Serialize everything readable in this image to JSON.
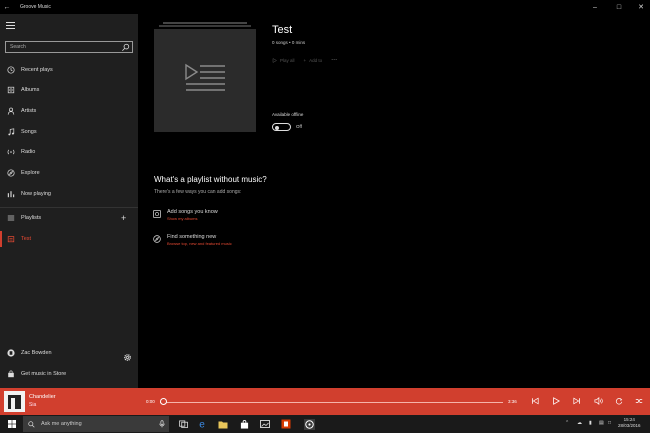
{
  "window": {
    "title": "Groove Music"
  },
  "sidebar": {
    "search_placeholder": "Search",
    "items": [
      {
        "label": "Recent plays",
        "icon": "clock-icon"
      },
      {
        "label": "Albums",
        "icon": "album-icon"
      },
      {
        "label": "Artists",
        "icon": "person-icon"
      },
      {
        "label": "Songs",
        "icon": "music-note-icon"
      },
      {
        "label": "Radio",
        "icon": "radio-icon"
      },
      {
        "label": "Explore",
        "icon": "explore-icon"
      },
      {
        "label": "Now playing",
        "icon": "equalizer-icon"
      }
    ],
    "playlists_label": "Playlists",
    "playlists": [
      {
        "label": "Test",
        "active": true
      }
    ],
    "user_name": "Zac Bowden",
    "store_label": "Get music in Store"
  },
  "playlist": {
    "title": "Test",
    "meta": "0 songs • 0 mins",
    "play_all": "Play all",
    "add_to": "Add to",
    "more": "···",
    "offline_label": "Available offline",
    "offline_state": "Off"
  },
  "empty_state": {
    "title": "What's a playlist without music?",
    "subtitle": "There's a few ways you can add songs:",
    "options": [
      {
        "title": "Add songs you know",
        "link": "Show my albums"
      },
      {
        "title": "Find something new",
        "link": "Browse top, new and featured music"
      }
    ]
  },
  "player": {
    "song": "Chandelier",
    "artist": "Sia",
    "elapsed": "0:00",
    "duration": "3:36",
    "progress": 0,
    "accent": "#d13f2e"
  },
  "taskbar": {
    "search_placeholder": "Ask me anything",
    "time": "15:24",
    "date": "28/03/2016"
  }
}
